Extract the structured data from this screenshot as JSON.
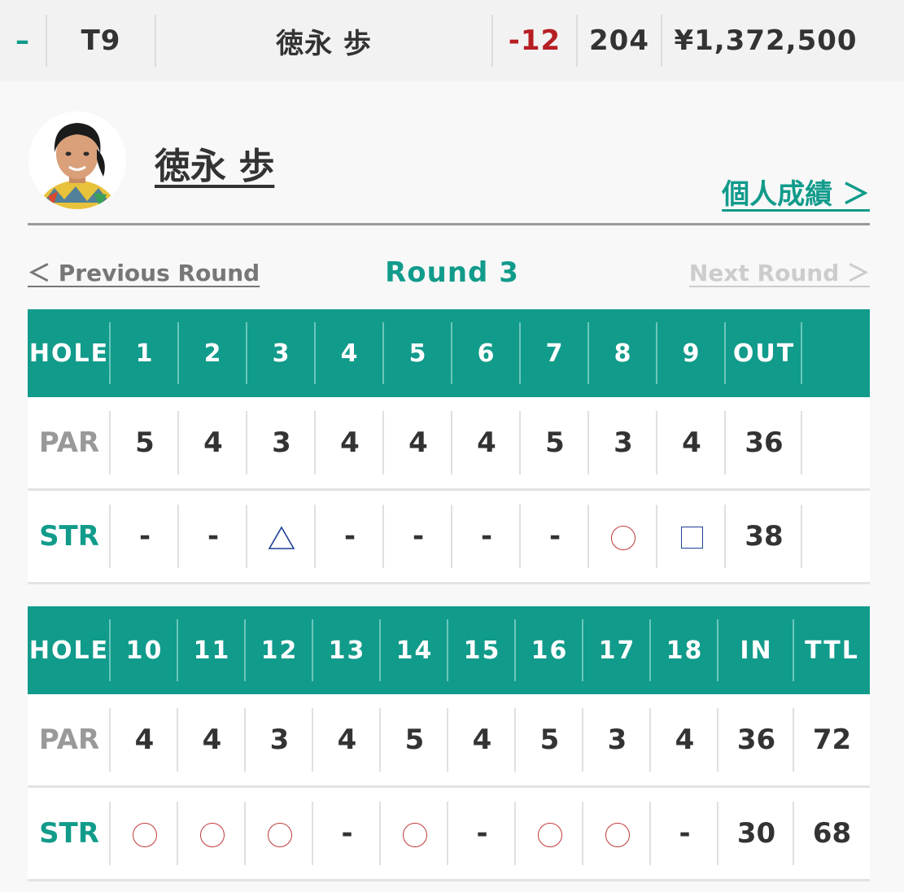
{
  "leaderboard_row": {
    "toggle": "–",
    "position": "T9",
    "name": "徳永 歩",
    "score": "-12",
    "total": "204",
    "prize": "¥1,372,500"
  },
  "player": {
    "name": "徳永 歩",
    "personal_link": "個人成績 ＞"
  },
  "round_nav": {
    "prev": "＜ Previous Round",
    "title": "Round 3",
    "next": "Next Round ＞"
  },
  "scorecard": {
    "front": {
      "header": [
        "HOLE",
        "1",
        "2",
        "3",
        "4",
        "5",
        "6",
        "7",
        "8",
        "9",
        "OUT",
        ""
      ],
      "par": [
        "PAR",
        "5",
        "4",
        "3",
        "4",
        "4",
        "4",
        "5",
        "3",
        "4",
        "36",
        ""
      ],
      "str": [
        {
          "label": "STR"
        },
        {
          "mark": "dash",
          "text": "-"
        },
        {
          "mark": "dash",
          "text": "-"
        },
        {
          "mark": "triangle"
        },
        {
          "mark": "dash",
          "text": "-"
        },
        {
          "mark": "dash",
          "text": "-"
        },
        {
          "mark": "dash",
          "text": "-"
        },
        {
          "mark": "dash",
          "text": "-"
        },
        {
          "mark": "circle"
        },
        {
          "mark": "square"
        },
        {
          "text": "38"
        },
        {
          "text": ""
        }
      ]
    },
    "back": {
      "header": [
        "HOLE",
        "10",
        "11",
        "12",
        "13",
        "14",
        "15",
        "16",
        "17",
        "18",
        "IN",
        "TTL"
      ],
      "par": [
        "PAR",
        "4",
        "4",
        "3",
        "4",
        "5",
        "4",
        "5",
        "3",
        "4",
        "36",
        "72"
      ],
      "str": [
        {
          "label": "STR"
        },
        {
          "mark": "circle"
        },
        {
          "mark": "circle"
        },
        {
          "mark": "circle"
        },
        {
          "mark": "dash",
          "text": "-"
        },
        {
          "mark": "circle"
        },
        {
          "mark": "dash",
          "text": "-"
        },
        {
          "mark": "circle"
        },
        {
          "mark": "circle"
        },
        {
          "mark": "dash",
          "text": "-"
        },
        {
          "text": "30"
        },
        {
          "text": "68"
        }
      ]
    }
  },
  "colors": {
    "accent": "#119b8b",
    "score_negative": "#b61e22",
    "birdie_circle": "#c0393b",
    "bogey_mark": "#1d3f94"
  }
}
